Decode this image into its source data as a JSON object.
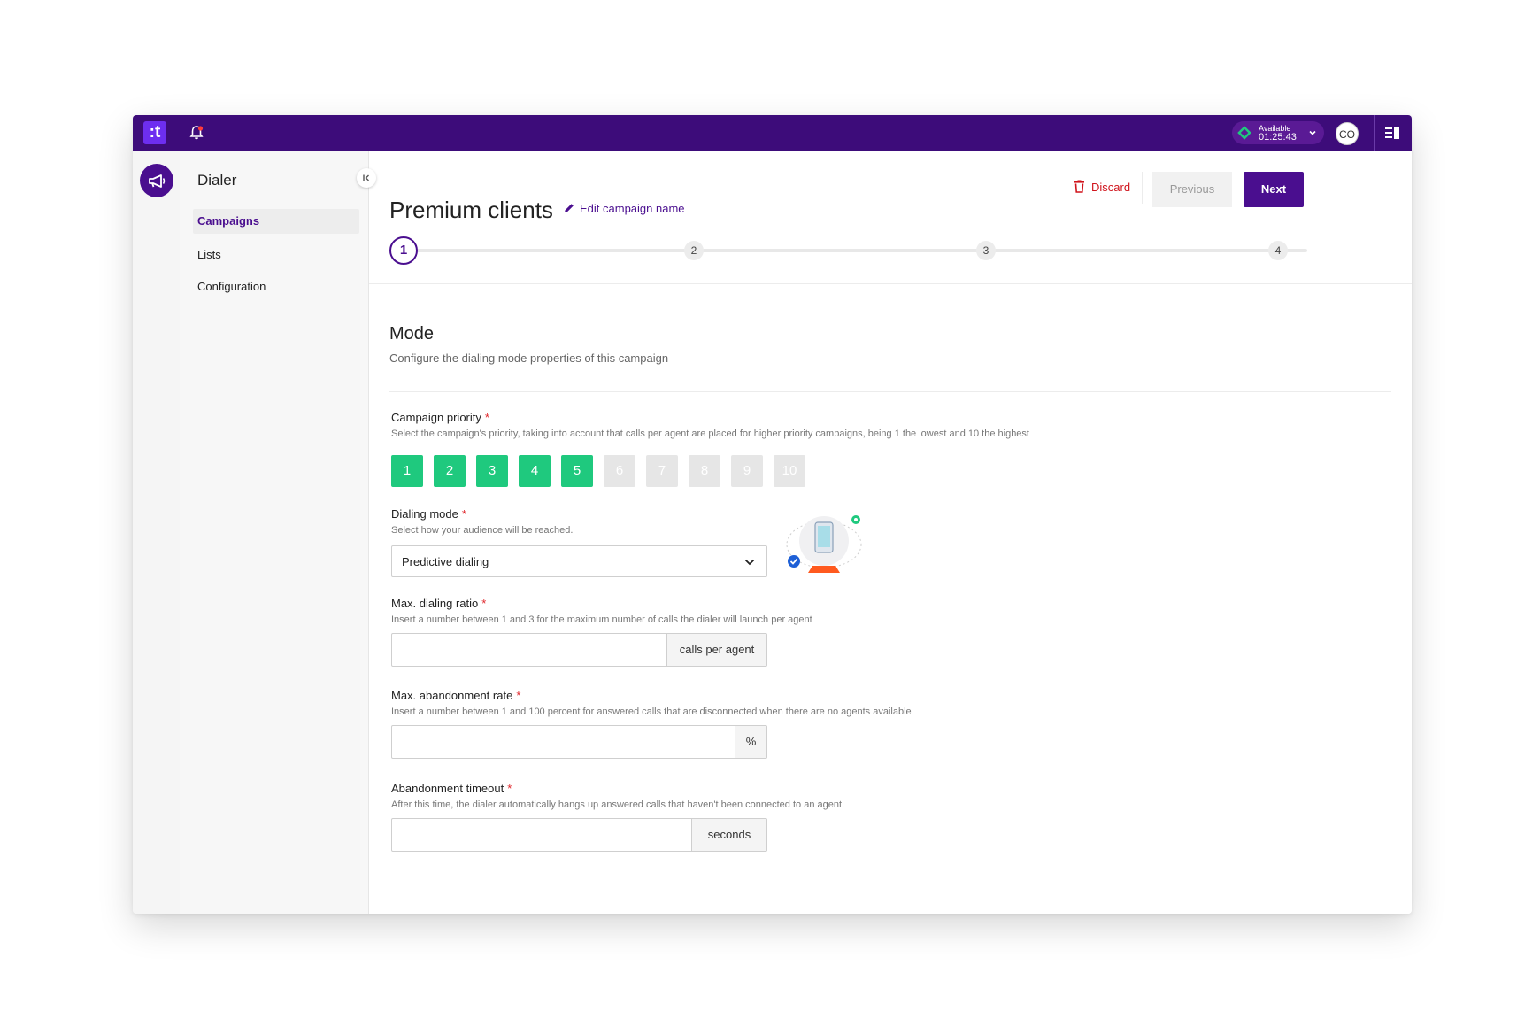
{
  "topbar": {
    "logo_text": ":t",
    "status_label": "Available",
    "status_time": "01:25:43",
    "avatar_initials": "CO",
    "accent": "#3d0c7a"
  },
  "sidebar": {
    "title": "Dialer",
    "items": [
      {
        "label": "Campaigns",
        "active": true
      },
      {
        "label": "Lists",
        "active": false
      },
      {
        "label": "Configuration",
        "active": false
      }
    ]
  },
  "header": {
    "title": "Premium clients",
    "edit_label": "Edit campaign name",
    "discard_label": "Discard",
    "previous_label": "Previous",
    "next_label": "Next"
  },
  "stepper": {
    "steps": [
      "1",
      "2",
      "3",
      "4"
    ],
    "current": 1
  },
  "section": {
    "title": "Mode",
    "description": "Configure the dialing mode properties of this campaign"
  },
  "fields": {
    "priority": {
      "label": "Campaign priority",
      "help": "Select the campaign's priority, taking into account that calls per agent are placed for higher priority campaigns, being 1 the lowest and 10 the highest",
      "options": [
        "1",
        "2",
        "3",
        "4",
        "5",
        "6",
        "7",
        "8",
        "9",
        "10"
      ],
      "selected": 5
    },
    "dialing_mode": {
      "label": "Dialing mode",
      "help": "Select how your audience will be reached.",
      "value": "Predictive dialing"
    },
    "max_ratio": {
      "label": "Max. dialing ratio",
      "help": "Insert a number between 1 and 3 for the maximum number of calls the dialer will launch per agent",
      "value": "",
      "addon": "calls per agent"
    },
    "max_abandon": {
      "label": "Max. abandonment rate",
      "help": "Insert a number between 1 and 100 percent for answered calls that are disconnected when there are no agents available",
      "value": "",
      "addon": "%"
    },
    "abandon_timeout": {
      "label": "Abandonment timeout",
      "help": "After this time, the dialer automatically hangs up answered calls that haven't been connected to an agent.",
      "value": "",
      "addon": "seconds"
    }
  },
  "colors": {
    "primary": "#4a0e8f",
    "priority_on": "#1fc97e",
    "priority_off": "#e6e6e6",
    "danger": "#d0141c",
    "required": "#e0252a"
  }
}
